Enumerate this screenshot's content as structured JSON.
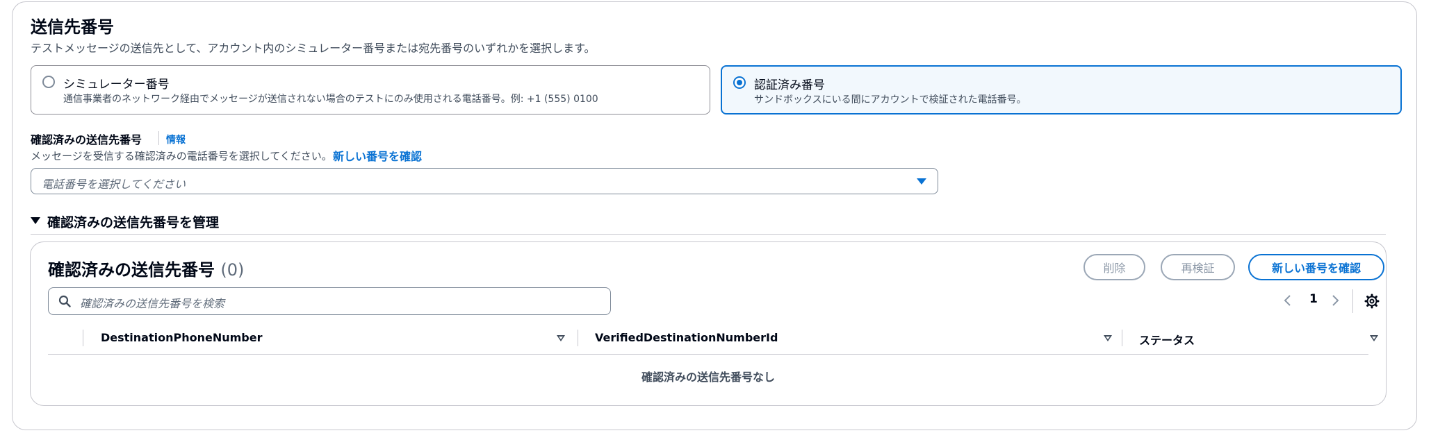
{
  "section": {
    "title": "送信先番号",
    "description": "テストメッセージの送信先として、アカウント内のシミュレーター番号または宛先番号のいずれかを選択します。"
  },
  "tiles": [
    {
      "label": "シミュレーター番号",
      "description": "通信事業者のネットワーク経由でメッセージが送信されない場合のテストにのみ使用される電話番号。例: +1 (555) 0100",
      "selected": false
    },
    {
      "label": "認証済み番号",
      "description": "サンドボックスにいる間にアカウントで検証された電話番号。",
      "selected": true
    }
  ],
  "field": {
    "label": "確認済みの送信先番号",
    "info": "情報",
    "description": "メッセージを受信する確認済みの電話番号を選択してください。",
    "description_link": "新しい番号を確認",
    "select_placeholder": "電話番号を選択してください"
  },
  "expandable": {
    "label": "確認済みの送信先番号を管理"
  },
  "table": {
    "title": "確認済みの送信先番号",
    "count": "(0)",
    "buttons": {
      "delete": "削除",
      "reverify": "再検証",
      "verify_new": "新しい番号を確認"
    },
    "search_placeholder": "確認済みの送信先番号を検索",
    "page": "1",
    "columns": [
      "DestinationPhoneNumber",
      "VerifiedDestinationNumberId",
      "ステータス"
    ],
    "empty": "確認済みの送信先番号なし"
  },
  "colors": {
    "accent": "#0972d3",
    "text": "#000716",
    "secondary": "#414d5c",
    "border": "#c6c6cd"
  }
}
